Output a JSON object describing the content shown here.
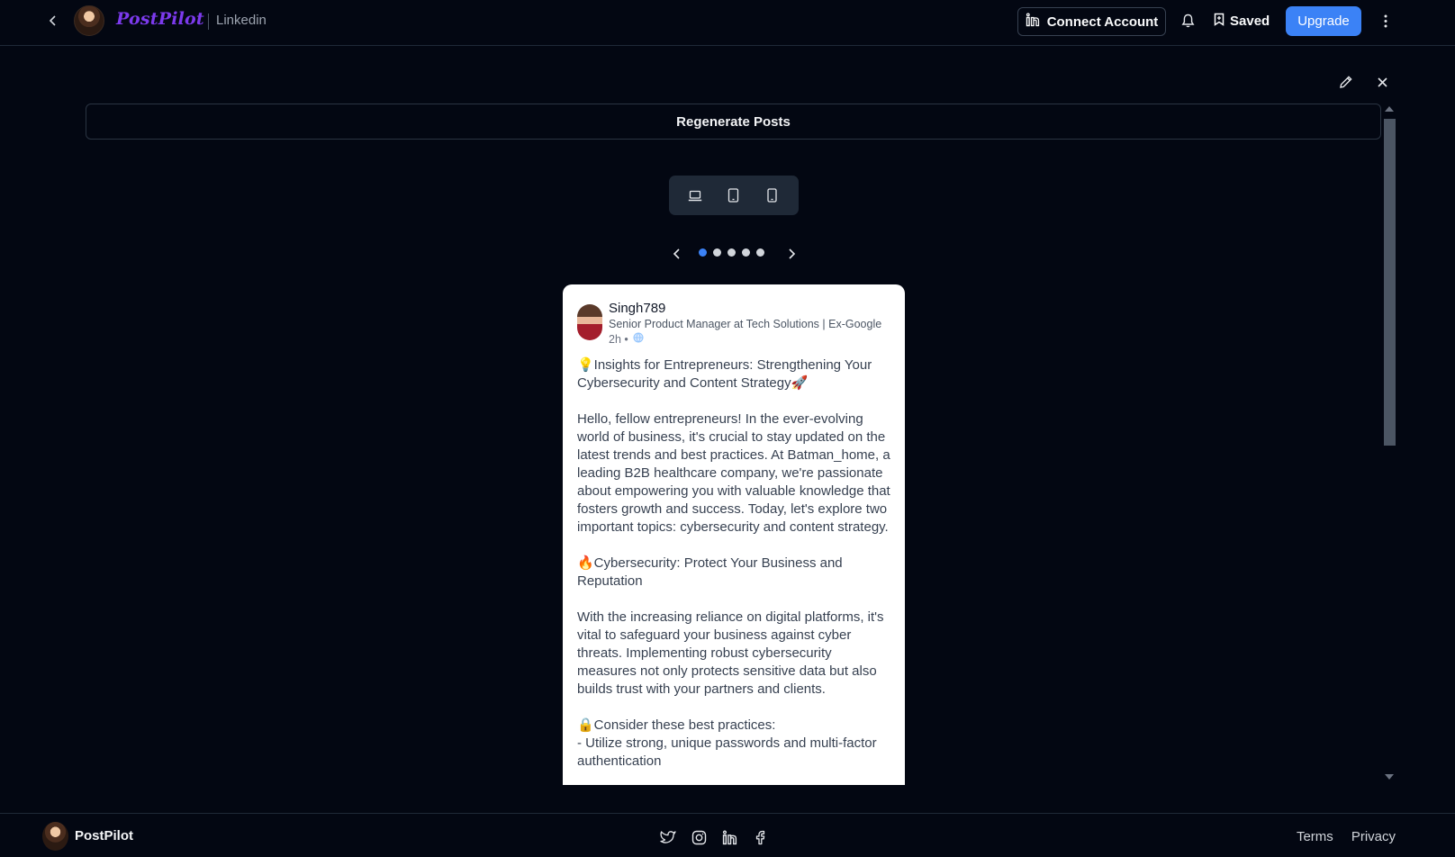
{
  "header": {
    "brand": "PostPilot",
    "platform": "Linkedin",
    "connect_label": "Connect Account",
    "saved_label": "Saved",
    "upgrade_label": "Upgrade"
  },
  "main": {
    "regenerate_label": "Regenerate Posts",
    "devices": [
      "laptop-icon",
      "tablet-icon",
      "phone-icon"
    ],
    "carousel": {
      "total": 5,
      "active_index": 0
    }
  },
  "post": {
    "author": "Singh789",
    "headline": "Senior Product Manager at Tech Solutions | Ex-Google",
    "time": "2h •",
    "body": "💡Insights for Entrepreneurs: Strengthening Your Cybersecurity and Content Strategy🚀\n\nHello, fellow entrepreneurs! In the ever-evolving world of business, it's crucial to stay updated on the latest trends and best practices. At Batman_home, a leading B2B healthcare company, we're passionate about empowering you with valuable knowledge that fosters growth and success. Today, let's explore two important topics: cybersecurity and content strategy.\n\n🔥Cybersecurity: Protect Your Business and Reputation\n\nWith the increasing reliance on digital platforms, it's vital to safeguard your business against cyber threats. Implementing robust cybersecurity measures not only protects sensitive data but also builds trust with your partners and clients.\n\n🔒Consider these best practices:\n- Utilize strong, unique passwords and multi-factor authentication"
  },
  "footer": {
    "brand": "PostPilot",
    "socials": [
      "twitter-icon",
      "instagram-icon",
      "linkedin-icon",
      "facebook-icon"
    ],
    "terms": "Terms",
    "privacy": "Privacy"
  },
  "colors": {
    "background": "#030712",
    "accent": "#3b82f6",
    "brand": "#7c3aed"
  }
}
